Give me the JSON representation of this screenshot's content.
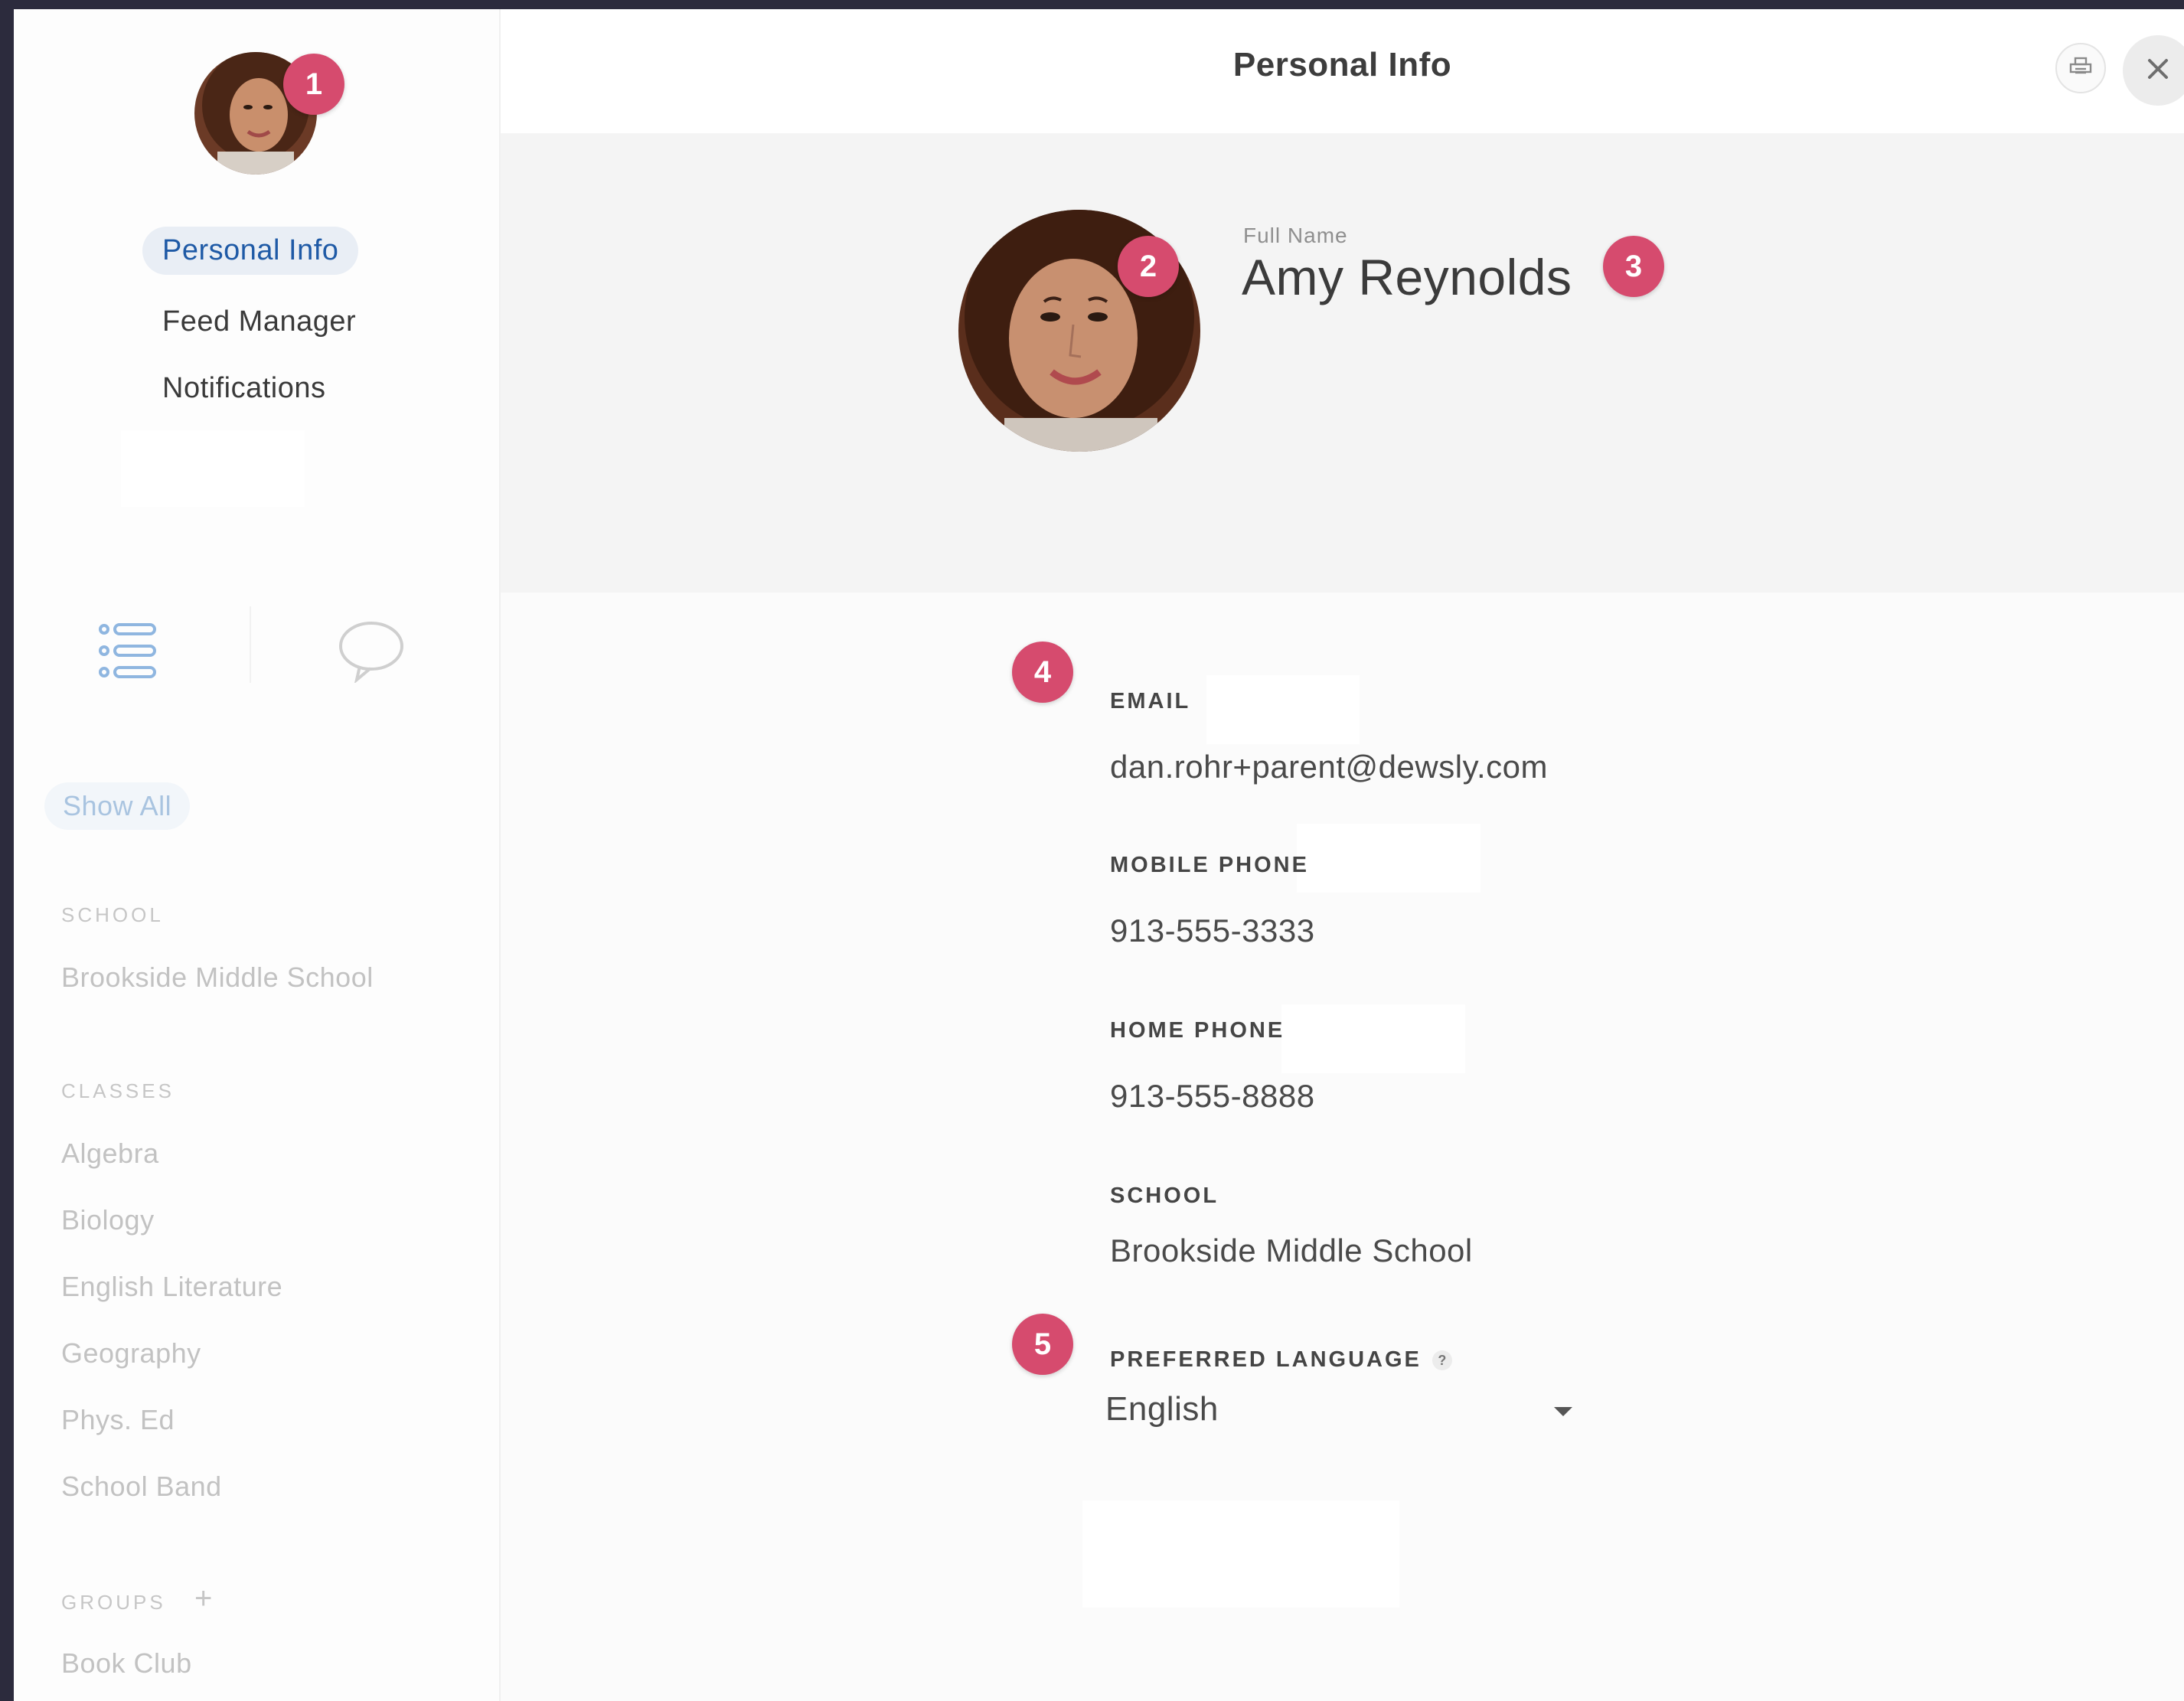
{
  "sidebar": {
    "nav": [
      {
        "label": "Personal Info",
        "active": true
      },
      {
        "label": "Feed Manager",
        "active": false
      },
      {
        "label": "Notifications",
        "active": false
      }
    ],
    "view_icons": [
      "list-icon",
      "chat-bubble-icon"
    ],
    "show_all": "Show All",
    "school_heading": "SCHOOL",
    "school_name": "Brookside Middle School",
    "classes_heading": "CLASSES",
    "classes": [
      "Algebra",
      "Biology",
      "English Literature",
      "Geography",
      "Phys. Ed",
      "School Band"
    ],
    "groups_heading": "GROUPS",
    "groups_add": "+",
    "groups": [
      "Book Club"
    ]
  },
  "header": {
    "title": "Personal Info",
    "print_icon": "print-icon",
    "close_icon": "close-icon"
  },
  "profile": {
    "full_name_label": "Full Name",
    "full_name": "Amy Reynolds"
  },
  "fields": {
    "email_label": "EMAIL",
    "email": "dan.rohr+parent@dewsly.com",
    "mobile_label": "MOBILE PHONE",
    "mobile": "913-555-3333",
    "home_label": "HOME PHONE",
    "home": "913-555-8888",
    "school_label": "SCHOOL",
    "school": "Brookside Middle School",
    "language_label": "PREFERRED LANGUAGE",
    "language_help": "?",
    "language": "English"
  },
  "annotations": [
    "1",
    "2",
    "3",
    "4",
    "5"
  ],
  "colors": {
    "badge": "#d64b6e",
    "active_nav_text": "#1f5aa6",
    "frame": "#2c2b3d"
  }
}
